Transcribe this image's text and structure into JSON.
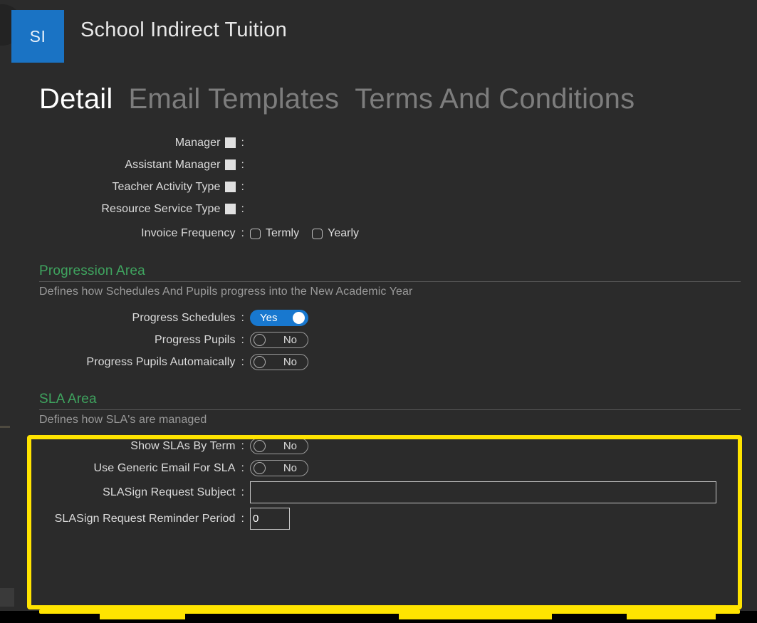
{
  "header": {
    "badge_text": "SI",
    "badge_color": "#1a73c4",
    "title": "School Indirect Tuition"
  },
  "tabs": [
    {
      "label": "Detail",
      "active": true
    },
    {
      "label": "Email Templates",
      "active": false
    },
    {
      "label": "Terms And Conditions",
      "active": false
    }
  ],
  "detail_fields": [
    {
      "label": "Manager",
      "has_square_icon": true,
      "control": "none"
    },
    {
      "label": "Assistant Manager",
      "has_square_icon": true,
      "control": "none"
    },
    {
      "label": "Teacher Activity Type",
      "has_square_icon": true,
      "control": "none"
    },
    {
      "label": "Resource Service Type",
      "has_square_icon": true,
      "control": "none"
    }
  ],
  "invoice_frequency": {
    "label": "Invoice Frequency",
    "options": [
      {
        "label": "Termly",
        "checked": false
      },
      {
        "label": "Yearly",
        "checked": false
      }
    ]
  },
  "progression_area": {
    "title": "Progression Area",
    "title_color": "#3fa45f",
    "description": "Defines how Schedules And Pupils progress into the New Academic Year",
    "toggles": [
      {
        "label": "Progress Schedules",
        "value": "Yes",
        "on": true
      },
      {
        "label": "Progress Pupils",
        "value": "No",
        "on": false
      },
      {
        "label": "Progress Pupils Automaically",
        "value": "No",
        "on": false
      }
    ]
  },
  "sla_area": {
    "title": "SLA Area",
    "title_color": "#3fa45f",
    "description": "Defines how SLA's are managed",
    "highlight_color": "#ffe400",
    "toggles": [
      {
        "label": "Show SLAs By Term",
        "value": "No",
        "on": false
      },
      {
        "label": "Use Generic Email For SLA",
        "value": "No",
        "on": false
      }
    ],
    "inputs": [
      {
        "label": "SLASign Request Subject",
        "value": "",
        "placeholder": "",
        "size": "wide"
      },
      {
        "label": "SLASign Request Reminder Period",
        "value": "0",
        "placeholder": "",
        "size": "small"
      }
    ]
  }
}
